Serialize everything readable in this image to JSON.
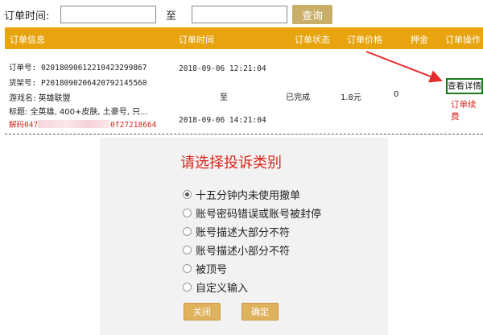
{
  "filter": {
    "label": "订单时间:",
    "to": "至",
    "start_value": "",
    "end_value": "",
    "query_label": "查询"
  },
  "table": {
    "headers": [
      "订单信息",
      "订单时间",
      "订单状态",
      "订单价格",
      "押金",
      "订单操作"
    ]
  },
  "order": {
    "order_no": "订单号: 02018090612210423299867",
    "listing_no": "货架号: P2018090206420792145560",
    "game": "游戏名: 英雄联盟",
    "title": "标题: 全英雄, 400+皮肤, 土豪号, 只...",
    "unlock_prefix": "解码047",
    "unlock_suffix": "0f27218664",
    "time_start": "2018-09-06 12:21:04",
    "time_to": "至",
    "time_end": "2018-09-06 14:21:04",
    "status": "已完成",
    "price": "1.8元",
    "deposit": "0",
    "detail_label": "查看详情",
    "renew_label": "订单续费"
  },
  "dialog": {
    "title": "请选择投诉类别",
    "options": [
      "十五分钟内未使用撤单",
      "账号密码错误或账号被封停",
      "账号描述大部分不符",
      "账号描述小部分不符",
      "被顶号",
      "自定义输入"
    ],
    "selected_index": 0,
    "close_label": "关闭",
    "ok_label": "确定"
  }
}
